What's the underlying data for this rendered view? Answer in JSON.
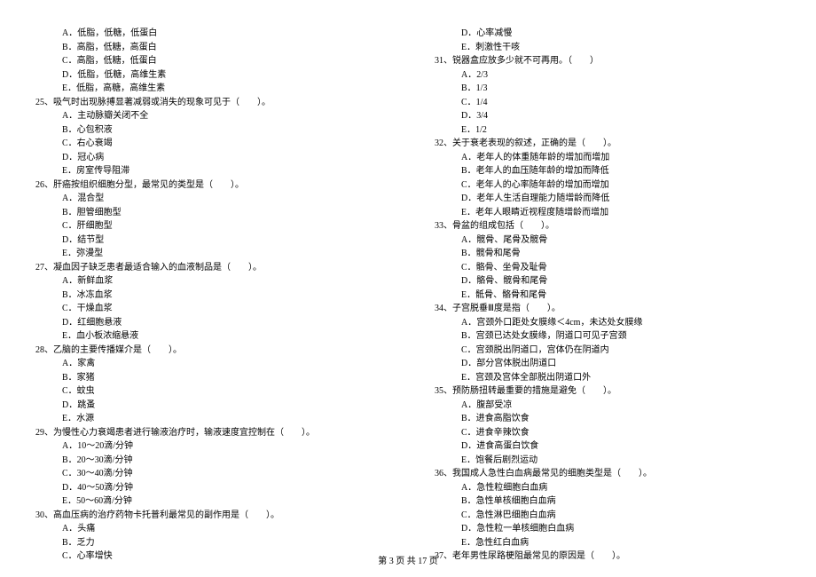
{
  "left": {
    "q24opts": [
      "A．低脂，低糖，低蛋白",
      "B．高脂，低糖，高蛋白",
      "C．高脂，低糖，低蛋白",
      "D．低脂，低糖，高维生素",
      "E．低脂，高糖，高维生素"
    ],
    "q25": "25、吸气时出现脉搏显著减弱或消失的现象可见于（　　）。",
    "q25opts": [
      "A．主动脉瓣关闭不全",
      "B．心包积液",
      "C．右心衰竭",
      "D．冠心病",
      "E．房室传导阻滞"
    ],
    "q26": "26、肝癌按组织细胞分型，最常见的类型是（　　）。",
    "q26opts": [
      "A．混合型",
      "B．胆管细胞型",
      "C．肝细胞型",
      "D．结节型",
      "E．弥漫型"
    ],
    "q27": "27、凝血因子缺乏患者最适合输入的血液制品是（　　）。",
    "q27opts": [
      "A．新鲜血浆",
      "B．冰冻血浆",
      "C．干燥血浆",
      "D．红细胞悬液",
      "E．血小板浓缩悬液"
    ],
    "q28": "28、乙脑的主要传播媒介是（　　）。",
    "q28opts": [
      "A．家禽",
      "B．家猪",
      "C．蚊虫",
      "D．跳蚤",
      "E．水源"
    ],
    "q29": "29、为慢性心力衰竭患者进行输液治疗时，输液速度宜控制在（　　）。",
    "q29opts": [
      "A．10～20滴/分钟",
      "B．20～30滴/分钟",
      "C．30～40滴/分钟",
      "D．40～50滴/分钟",
      "E．50～60滴/分钟"
    ],
    "q30": "30、高血压病的治疗药物卡托普利最常见的副作用是（　　）。",
    "q30opts": [
      "A．头痛",
      "B．乏力",
      "C．心率增快"
    ]
  },
  "right": {
    "q30cont": [
      "D．心率减慢",
      "E．刺激性干咳"
    ],
    "q31": "31、锐器盒应放多少就不可再用。（　　）",
    "q31opts": [
      "A．2/3",
      "B．1/3",
      "C．1/4",
      "D．3/4",
      "E．1/2"
    ],
    "q32": "32、关于衰老表现的叙述，正确的是（　　）。",
    "q32opts": [
      "A．老年人的体重随年龄的增加而增加",
      "B．老年人的血压随年龄的增加而降低",
      "C．老年人的心率随年龄的增加而增加",
      "D．老年人生活自理能力随增龄而降低",
      "E．老年人眼睛近视程度随增龄而增加"
    ],
    "q33": "33、骨盆的组成包括（　　）。",
    "q33opts": [
      "A．髋骨、尾骨及髋骨",
      "B．髋骨和尾骨",
      "C．骼骨、坐骨及耻骨",
      "D．骼骨、髋骨和尾骨",
      "E．骶骨、骼骨和尾骨"
    ],
    "q34": "34、子宫脱垂Ⅲ度是指（　　）。",
    "q34opts": [
      "A．宫颈外口距处女膜缘＜4cm，未达处女膜缘",
      "B．宫颈已达处女膜缘，阴道口可见子宫颈",
      "C．宫颈脱出阴道口，宫体仍在阴道内",
      "D．部分宫体脱出阴道口",
      "E．宫颈及宫体全部脱出阴道口外"
    ],
    "q35": "35、预防肠扭转最重要的措施是避免（　　）。",
    "q35opts": [
      "A．腹部受凉",
      "B．进食高脂饮食",
      "C．进食辛辣饮食",
      "D．进食高蛋白饮食",
      "E．饱餐后剧烈运动"
    ],
    "q36": "36、我国成人急性白血病最常见的细胞类型是（　　）。",
    "q36opts": [
      "A．急性粒细胞白血病",
      "B．急性单核细胞白血病",
      "C．急性淋巴细胞白血病",
      "D．急性粒一单核细胞白血病",
      "E．急性红白血病"
    ],
    "q37": "37、老年男性尿路梗阻最常见的原因是（　　）。"
  },
  "footer": "第 3 页 共 17 页"
}
